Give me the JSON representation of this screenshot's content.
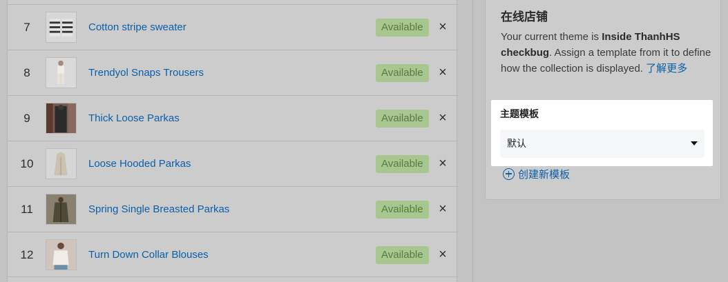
{
  "products": [
    {
      "index": "7",
      "name": "Cotton stripe sweater",
      "status": "Available",
      "thumb": "striped-sweater-thumb"
    },
    {
      "index": "8",
      "name": "Trendyol Snaps Trousers",
      "status": "Available",
      "thumb": "trousers-thumb"
    },
    {
      "index": "9",
      "name": "Thick Loose Parkas",
      "status": "Available",
      "thumb": "dark-parka-thumb"
    },
    {
      "index": "10",
      "name": "Loose Hooded Parkas",
      "status": "Available",
      "thumb": "beige-parka-thumb"
    },
    {
      "index": "11",
      "name": "Spring Single Breasted Parkas",
      "status": "Available",
      "thumb": "olive-parka-thumb"
    },
    {
      "index": "12",
      "name": "Turn Down Collar Blouses",
      "status": "Available",
      "thumb": "blouse-thumb"
    }
  ],
  "remove_icon": "×",
  "panel": {
    "title": "在线店铺",
    "desc_prefix": "Your current theme is ",
    "theme_name": "Inside ThanhHS checkbug",
    "desc_suffix": ". Assign a template from it to define how the collection is displayed. ",
    "learn_more": "了解更多"
  },
  "template": {
    "label": "主题模板",
    "selected": "默认"
  },
  "create_template": "创建新模板",
  "colors": {
    "link": "#0b5fa8",
    "badge_bg": "#a8c790",
    "badge_text": "#5a7a40",
    "overlay": "#cccccc"
  }
}
